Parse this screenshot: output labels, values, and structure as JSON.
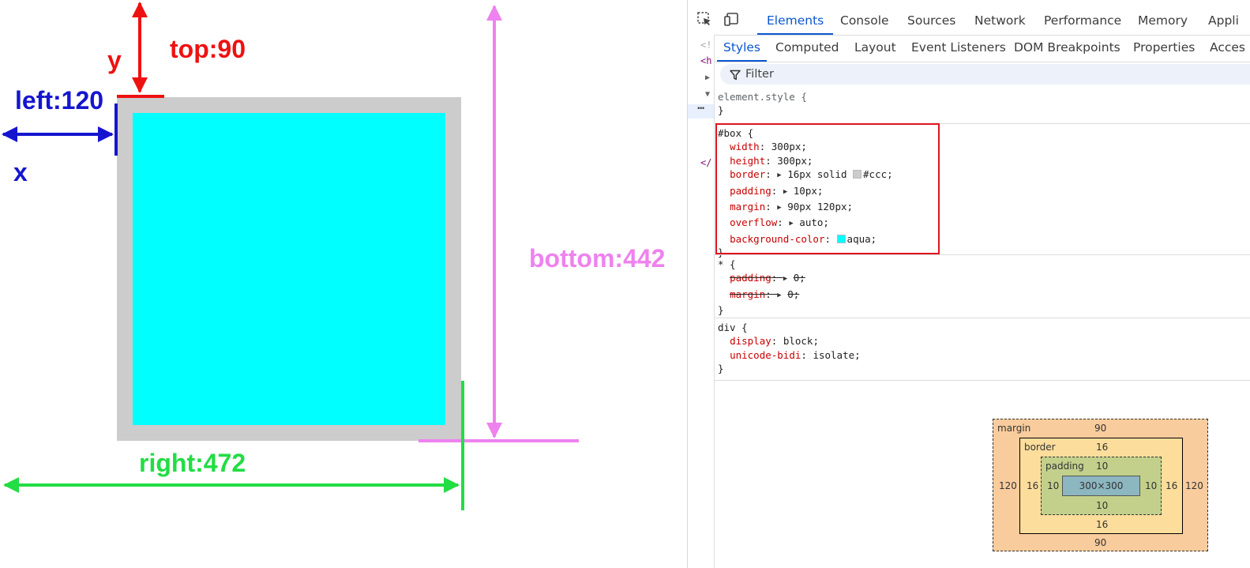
{
  "diagram": {
    "labels": {
      "y": "y",
      "top": "top:90",
      "left": "left:120",
      "x": "x",
      "bottom": "bottom:442",
      "right": "right:472"
    },
    "colors": {
      "red": "#ee1111",
      "blue": "#1515d0",
      "pink": "#ee82ee",
      "green": "#22dd44",
      "box_border": "#cccccc",
      "box_fill": "#00ffff"
    }
  },
  "devtools": {
    "toolbar": {
      "icons": [
        "inspect-element-icon",
        "device-toolbar-icon"
      ],
      "tabs": [
        "Elements",
        "Console",
        "Sources",
        "Network",
        "Performance",
        "Memory",
        "Appli"
      ],
      "active_tab": "Elements"
    },
    "elements_gutter": {
      "fragments": [
        "<!",
        "<h",
        "</"
      ]
    },
    "subtabs": {
      "tabs": [
        "Styles",
        "Computed",
        "Layout",
        "Event Listeners",
        "DOM Breakpoints",
        "Properties",
        "Acces"
      ],
      "active_tab": "Styles"
    },
    "filter": {
      "placeholder": "Filter"
    },
    "rules": {
      "element_style": {
        "selector": "element.style {",
        "close": "}"
      },
      "box": {
        "selector": "#box {",
        "props": [
          {
            "name": "width",
            "value": "300px;"
          },
          {
            "name": "height",
            "value": "300px;"
          },
          {
            "name": "border",
            "value": "16px solid",
            "color_value": "#ccc;",
            "swatch": "#cccccc"
          },
          {
            "name": "padding",
            "value": "10px;"
          },
          {
            "name": "margin",
            "value": "90px 120px;"
          },
          {
            "name": "overflow",
            "value": "auto;"
          },
          {
            "name": "background-color",
            "color_value": "aqua;",
            "swatch": "#00ffff"
          }
        ],
        "close": "}"
      },
      "universal": {
        "selector": "* {",
        "props": [
          {
            "name": "padding",
            "value": "0;"
          },
          {
            "name": "margin",
            "value": "0;"
          }
        ],
        "close": "}"
      },
      "div": {
        "selector": "div {",
        "props": [
          {
            "name": "display",
            "value": "block;"
          },
          {
            "name": "unicode-bidi",
            "value": "isolate;"
          }
        ],
        "close": "}"
      }
    },
    "box_model": {
      "margin": {
        "label": "margin",
        "top": "90",
        "right": "120",
        "bottom": "90",
        "left": "120"
      },
      "border": {
        "label": "border",
        "top": "16",
        "right": "16",
        "bottom": "16",
        "left": "16"
      },
      "padding": {
        "label": "padding",
        "top": "10",
        "right": "10",
        "bottom": "10",
        "left": "10"
      },
      "content": "300×300"
    }
  }
}
